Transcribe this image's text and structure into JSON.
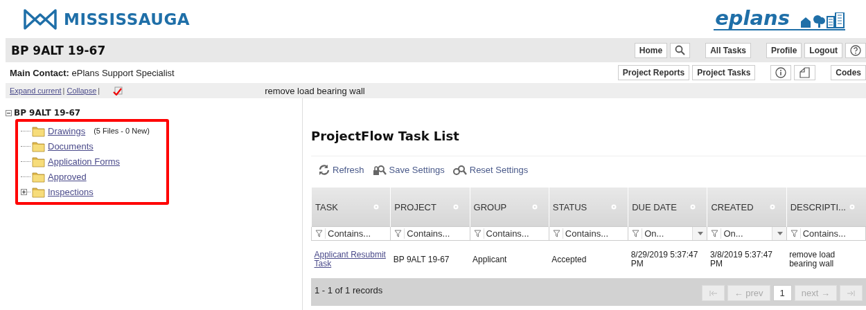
{
  "header": {
    "city_logo": "MISSISSAUGA",
    "product_logo": "eplans"
  },
  "project_bar": {
    "title": "BP 9ALT 19-67",
    "buttons": [
      {
        "kind": "text",
        "label": "Home"
      },
      {
        "kind": "search"
      },
      {
        "kind": "text",
        "label": "All Tasks"
      },
      {
        "kind": "text",
        "label": "Profile"
      },
      {
        "kind": "text",
        "label": "Logout"
      },
      {
        "kind": "help"
      }
    ]
  },
  "contact_bar": {
    "label": "Main Contact:",
    "value": "ePlans Support Specialist",
    "buttons": [
      {
        "kind": "text",
        "label": "Project Reports"
      },
      {
        "kind": "text",
        "label": "Project Tasks"
      },
      {
        "kind": "info"
      },
      {
        "kind": "note"
      },
      {
        "kind": "text",
        "label": "Codes"
      }
    ]
  },
  "tree_toolbar": {
    "links": [
      "Expand current",
      "Collapse"
    ],
    "separator": "|",
    "description": "remove load bearing wall"
  },
  "tree": {
    "root": "BP 9ALT 19-67",
    "expanded": true,
    "children": [
      {
        "label": "Drawings",
        "note": "(5 Files - 0 New)",
        "expandable": false
      },
      {
        "label": "Documents",
        "expandable": false
      },
      {
        "label": "Application Forms",
        "expandable": false
      },
      {
        "label": "Approved",
        "expandable": false
      },
      {
        "label": "Inspections",
        "expandable": true
      }
    ]
  },
  "task_list": {
    "title": "ProjectFlow Task List",
    "actions": [
      {
        "kind": "refresh",
        "label": "Refresh"
      },
      {
        "kind": "save",
        "label": "Save Settings"
      },
      {
        "kind": "reset",
        "label": "Reset Settings"
      }
    ],
    "columns": [
      {
        "label": "TASK",
        "filter": "Contains...",
        "dropdown": false
      },
      {
        "label": "PROJECT",
        "filter": "Contains...",
        "dropdown": false
      },
      {
        "label": "GROUP",
        "filter": "Contains...",
        "dropdown": false
      },
      {
        "label": "STATUS",
        "filter": "Contains...",
        "dropdown": false
      },
      {
        "label": "DUE DATE",
        "filter": "On...",
        "dropdown": true
      },
      {
        "label": "CREATED",
        "filter": "On...",
        "dropdown": true
      },
      {
        "label": "DESCRIPTI...",
        "filter": "Contains...",
        "dropdown": false
      }
    ],
    "rows": [
      {
        "cells": [
          "Applicant Resubmit Task",
          "BP 9ALT 19-67",
          "Applicant",
          "Accepted",
          "8/29/2019 5:37:47 PM",
          "3/8/2019 5:37:47 PM",
          "remove load bearing wall"
        ]
      }
    ],
    "summary": "1 - 1 of 1 records",
    "pager": [
      {
        "kind": "first",
        "disabled": true
      },
      {
        "kind": "prev",
        "label": "← prev",
        "disabled": true
      },
      {
        "kind": "page",
        "label": "1",
        "selected": true
      },
      {
        "kind": "next",
        "label": "next →",
        "disabled": true
      },
      {
        "kind": "last",
        "disabled": true
      }
    ]
  }
}
